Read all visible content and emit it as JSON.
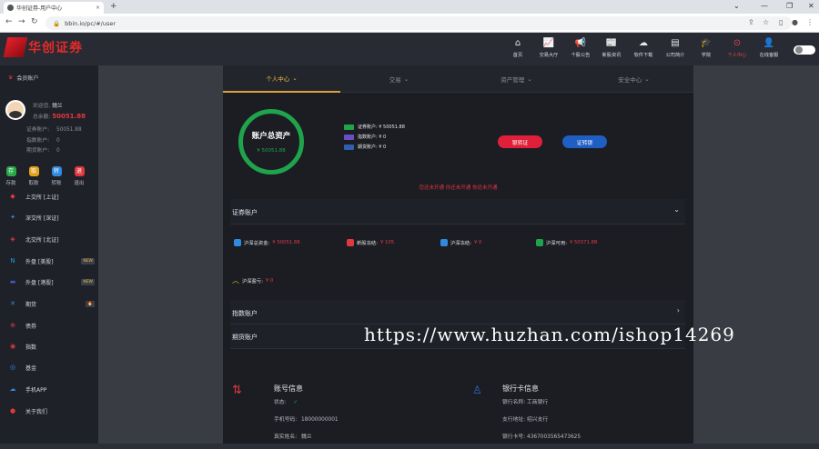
{
  "browser": {
    "tab_title": "华创证券-用户中心",
    "url": "bbin.io/pc/#/user",
    "new_tab": "+"
  },
  "header": {
    "logo": "华创证券",
    "nav": [
      {
        "label": "首页",
        "icon": "home-icon",
        "glyph": "⌂"
      },
      {
        "label": "交易大厅",
        "icon": "chart-icon",
        "glyph": "📈"
      },
      {
        "label": "个股公告",
        "icon": "megaphone-icon",
        "glyph": "📢"
      },
      {
        "label": "新股资讯",
        "icon": "news-icon",
        "glyph": "📰"
      },
      {
        "label": "软件下载",
        "icon": "download-icon",
        "glyph": "☁"
      },
      {
        "label": "公司简介",
        "icon": "company-icon",
        "glyph": "▤"
      },
      {
        "label": "学院",
        "icon": "academy-icon",
        "glyph": "🎓"
      },
      {
        "label": "个人中心",
        "icon": "user-icon",
        "glyph": "⊙",
        "active": true
      },
      {
        "label": "在线客服",
        "icon": "support-icon",
        "glyph": "👤"
      }
    ]
  },
  "sidebar": {
    "member_title": "会员账户",
    "greeting_label": "欢迎您,",
    "greeting_name": "魏兰",
    "total_label": "总余额:",
    "total_value": "50051.88",
    "securities_label": "证券账户:",
    "securities_value": "50051.88",
    "index_label": "指数账户:",
    "index_value": "0",
    "futures_label": "期货账户:",
    "futures_value": "0",
    "quick": [
      {
        "label": "存款",
        "glyph": "存",
        "color": "#2aa84a"
      },
      {
        "label": "取款",
        "glyph": "取",
        "color": "#e2a21e"
      },
      {
        "label": "转账",
        "glyph": "转",
        "color": "#2f8ae0"
      },
      {
        "label": "退出",
        "glyph": "退",
        "color": "#e0383f"
      }
    ],
    "items": [
      {
        "label": "上交所 [上证]",
        "glyph": "◆",
        "color": "#e0383f",
        "new": ""
      },
      {
        "label": "深交所 [深证]",
        "glyph": "✦",
        "color": "#2f8ae0",
        "new": ""
      },
      {
        "label": "北交所 [北证]",
        "glyph": "◈",
        "color": "#e0383f",
        "new": ""
      },
      {
        "label": "外盘 [美股]",
        "glyph": "N",
        "color": "#1e9ee0",
        "new": "NEW"
      },
      {
        "label": "外盘 [港股]",
        "glyph": "▬",
        "color": "#4257c7",
        "new": "NEW"
      },
      {
        "label": "期货",
        "glyph": "✕",
        "color": "#2f8ae0",
        "new": "🔥"
      },
      {
        "label": "债券",
        "glyph": "⊕",
        "color": "#e0383f",
        "new": ""
      },
      {
        "label": "指数",
        "glyph": "◉",
        "color": "#e0383f",
        "new": ""
      },
      {
        "label": "基金",
        "glyph": "◎",
        "color": "#2f8ae0",
        "new": ""
      },
      {
        "label": "手机APP",
        "glyph": "☁",
        "color": "#2f8ae0",
        "new": ""
      },
      {
        "label": "关于我们",
        "glyph": "●",
        "color": "#e0383f",
        "new": ""
      }
    ]
  },
  "subtabs": [
    "个人中心",
    "交易",
    "资产管理",
    "安全中心"
  ],
  "assets": {
    "ring_title": "账户总资产",
    "ring_value": "¥ 50051.88",
    "legend": [
      {
        "label": "证券账户: ¥ 50051.88",
        "color": "#1fa44c"
      },
      {
        "label": "指数账户: ¥ 0",
        "color": "#6a4fc4"
      },
      {
        "label": "期货账户: ¥ 0",
        "color": "#2f5fb0"
      }
    ],
    "buttons": [
      {
        "label": "银转证",
        "color": "#e0203a"
      },
      {
        "label": "证转银",
        "color": "#1f5fc4"
      }
    ],
    "warning": "您还未开通 你还未开通 你还未开通"
  },
  "securities": {
    "title": "证券账户",
    "stats": [
      {
        "label": "沪深总资金:",
        "value": "¥ 50051.88",
        "color": "#2f8ae0"
      },
      {
        "label": "新股冻结:",
        "value": "¥ 105",
        "color": "#e0383f"
      },
      {
        "label": "沪深冻结:",
        "value": "¥ 0",
        "color": "#2f8ae0"
      },
      {
        "label": "沪深可用:",
        "value": "¥ 50371.88",
        "color": "#1fa44c"
      }
    ],
    "profit_label": "沪深盈亏:",
    "profit_value": "¥ 0"
  },
  "index_section": {
    "title": "指数账户"
  },
  "futures_section": {
    "title": "期货账户"
  },
  "account_info": {
    "title": "账号信息",
    "status_label": "状态:",
    "status_value": "✓",
    "phone_label": "手机号码:",
    "phone_value": "18000000001",
    "name_label": "真实姓名:",
    "name_value": "魏兰"
  },
  "bank_info": {
    "title": "银行卡信息",
    "bank_label": "银行名称:",
    "bank_value": "工商银行",
    "branch_label": "支行地址:",
    "branch_value": "绍兴支行",
    "card_label": "银行卡号:",
    "card_value": "4367003565473625"
  },
  "watermark": "https://www.huzhan.com/ishop14269"
}
